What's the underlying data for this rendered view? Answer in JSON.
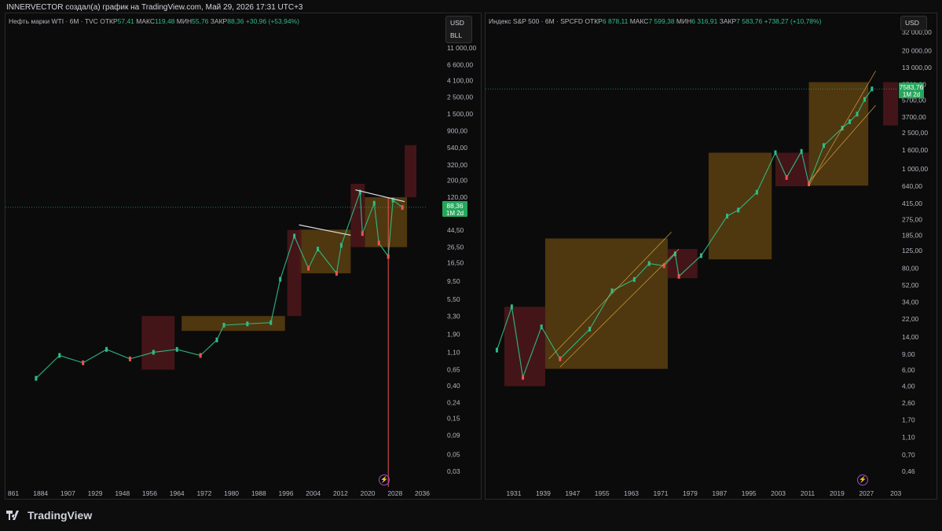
{
  "header": {
    "text": "INNERVECTOR создал(а) график на TradingView.com, Май 29, 2026 17:31 UTC+3"
  },
  "footer": {
    "brand": "TradingView"
  },
  "colors": {
    "up": "#2ebd85",
    "down": "#ef5350",
    "orange_box": "#5c3f10",
    "red_box": "#4a1619",
    "background": "#0b0b0b"
  },
  "left_chart": {
    "symbol": "Нефть марки WTI · 6M · TVC",
    "open_label": "ОТКР",
    "open": "57,41",
    "high_label": "МАКС",
    "high": "119,48",
    "low_label": "МИН",
    "low": "55,76",
    "close_label": "ЗАКР",
    "close": "88,36",
    "change": "+30,96 (+53,94%)",
    "currency": "USD",
    "unit": "BLL",
    "price_tag": "88,36",
    "price_tag_sub": "1M 2d"
  },
  "right_chart": {
    "symbol": "Индекс S&P 500 · 6M · SPCFD",
    "open_label": "ОТКР",
    "open": "6 878,11",
    "high_label": "МАКС",
    "high": "7 599,38",
    "low_label": "МИН",
    "low": "6 316,91",
    "close_label": "ЗАКР",
    "close": "7 583,76",
    "change": "+738,27 (+10,78%)",
    "currency": "USD",
    "price_tag": "7583,76",
    "price_tag_sub": "1M 2d"
  },
  "chart_data": [
    {
      "type": "line",
      "title": "Нефть марки WTI · 6M · TVC",
      "scale": "log",
      "y_ticks": [
        "11 000,00",
        "6 600,00",
        "4 100,00",
        "2 500,00",
        "1 500,00",
        "900,00",
        "540,00",
        "320,00",
        "200,00",
        "120,00",
        "44,50",
        "26,50",
        "16,50",
        "9,50",
        "5,50",
        "3,30",
        "1,90",
        "1,10",
        "0,65",
        "0,40",
        "0,24",
        "0,15",
        "0,09",
        "0,05",
        "0,03"
      ],
      "x_ticks": [
        "861",
        "1884",
        "1907",
        "1929",
        "1948",
        "1956",
        "1964",
        "1972",
        "1980",
        "1988",
        "1996",
        "2004",
        "2012",
        "2020",
        "2028",
        "2036"
      ],
      "series": [
        {
          "x": [
            1870,
            1880,
            1890,
            1900,
            1910,
            1920,
            1930,
            1940,
            1947,
            1950,
            1960,
            1970,
            1974,
            1980,
            1986,
            1990,
            1998,
            2000,
            2008,
            2009,
            2014,
            2016,
            2020,
            2022,
            2026
          ],
          "y": [
            0.5,
            1.0,
            0.8,
            1.2,
            0.9,
            1.1,
            1.2,
            1.0,
            1.6,
            2.5,
            2.6,
            2.7,
            10,
            37,
            14,
            25,
            12,
            28,
            140,
            40,
            100,
            30,
            20,
            110,
            88
          ]
        }
      ],
      "annotations": {
        "red_zones": [
          [
            1915,
            1929,
            0.65,
            3.3
          ],
          [
            1977,
            1983,
            3.3,
            44.5
          ],
          [
            2004,
            2010,
            26.5,
            180
          ],
          [
            2027,
            2032,
            120,
            580
          ]
        ],
        "orange_zones": [
          [
            1932,
            1976,
            2.1,
            3.3
          ],
          [
            1982,
            2004,
            12,
            45
          ],
          [
            2010,
            2028,
            26.5,
            120
          ]
        ],
        "trend_lines": [
          [
            1982,
            52,
            2004,
            38
          ],
          [
            2006,
            150,
            2027,
            105
          ]
        ],
        "vertical_line_year": 2020
      }
    },
    {
      "type": "line",
      "title": "Индекс S&P 500 · 6M · SPCFD",
      "scale": "log",
      "y_ticks": [
        "32 000,00",
        "20 000,00",
        "13 000,00",
        "8500,00",
        "5700,00",
        "3700,00",
        "2 500,00",
        "1 600,00",
        "1 000,00",
        "640,00",
        "415,00",
        "275,00",
        "185,00",
        "125,00",
        "80,00",
        "52,00",
        "34,00",
        "22,00",
        "14,00",
        "9,00",
        "6,00",
        "4,00",
        "2,60",
        "1,70",
        "1,10",
        "0,70",
        "0,46"
      ],
      "x_ticks": [
        "1931",
        "1939",
        "1947",
        "1955",
        "1963",
        "1971",
        "1979",
        "1987",
        "1995",
        "2003",
        "2011",
        "2019",
        "2027",
        "203"
      ],
      "series": [
        {
          "x": [
            1925,
            1929,
            1932,
            1937,
            1942,
            1950,
            1956,
            1962,
            1966,
            1970,
            1973,
            1974,
            1980,
            1987,
            1990,
            1995,
            2000,
            2003,
            2007,
            2009,
            2013,
            2018,
            2020,
            2022,
            2024,
            2026
          ],
          "y": [
            10,
            30,
            5,
            18,
            8,
            17,
            45,
            60,
            90,
            85,
            115,
            65,
            110,
            300,
            350,
            550,
            1500,
            800,
            1550,
            680,
            1800,
            2800,
            3300,
            4000,
            5800,
            7583
          ]
        }
      ],
      "annotations": {
        "red_zones": [
          [
            1927,
            1938,
            4,
            30
          ],
          [
            1971,
            1979,
            62,
            130
          ],
          [
            2000,
            2009,
            640,
            1500
          ],
          [
            2029,
            2033,
            3000,
            9000
          ]
        ],
        "orange_zones": [
          [
            1938,
            1971,
            6.2,
            170
          ],
          [
            1982,
            1999,
            100,
            1500
          ],
          [
            2009,
            2025,
            650,
            9000
          ]
        ]
      }
    }
  ]
}
